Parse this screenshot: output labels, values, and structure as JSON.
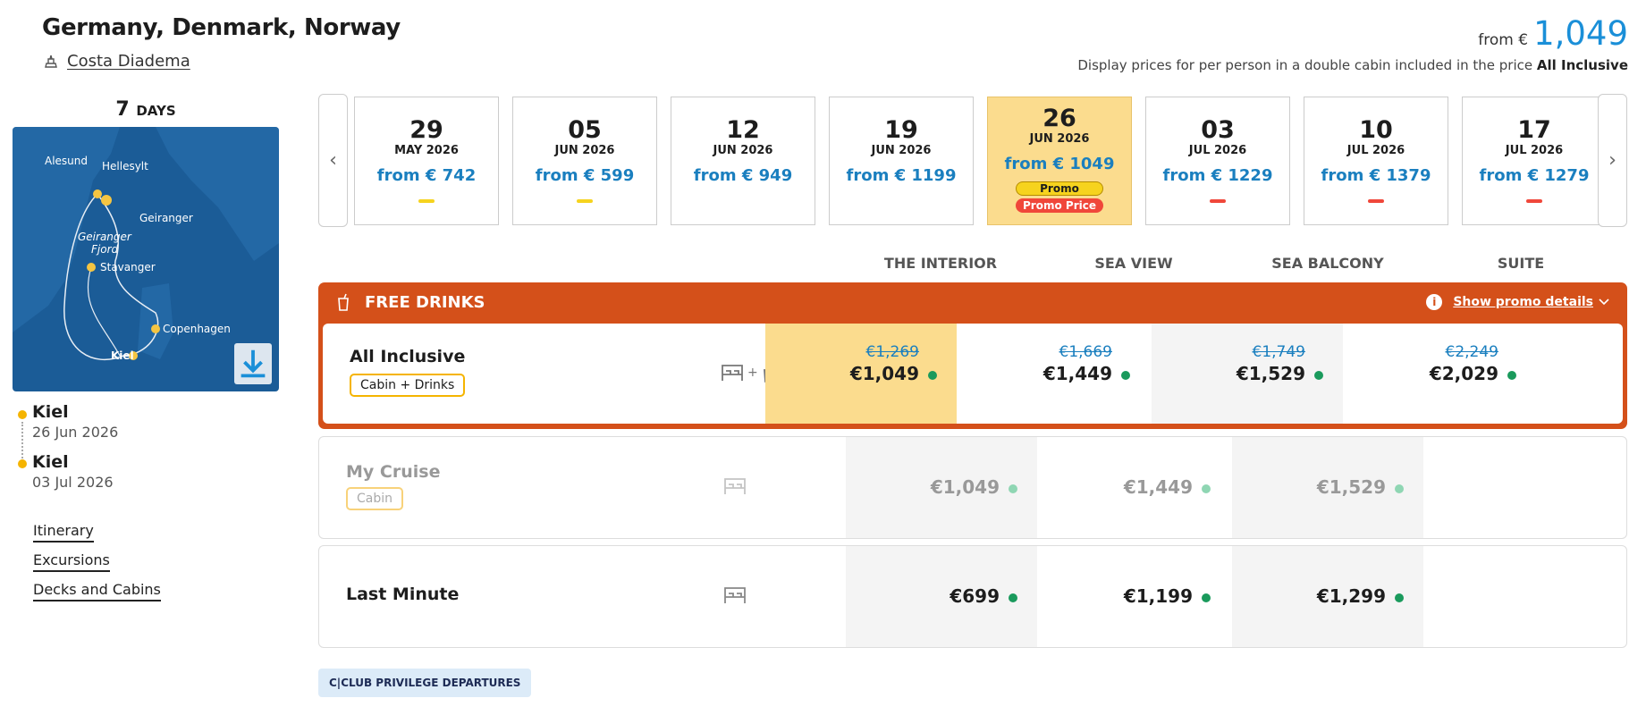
{
  "header": {
    "title": "Germany, Denmark, Norway",
    "ship": "Costa Diadema",
    "from_label": "from €",
    "from_value": "1,049",
    "note_text": "Display prices for per person in a double cabin included in the price",
    "note_bold": "All Inclusive"
  },
  "left": {
    "days_num": "7",
    "days_label": "DAYS",
    "map_labels": [
      "Alesund",
      "Hellesylt",
      "Geiranger",
      "Geiranger",
      "Fjord",
      "Stavanger",
      "Copenhagen",
      "Kiel"
    ],
    "ports": [
      {
        "name": "Kiel",
        "date": "26 Jun 2026"
      },
      {
        "name": "Kiel",
        "date": "03 Jul 2026"
      }
    ],
    "links": [
      "Itinerary",
      "Excursions",
      "Decks and Cabins"
    ]
  },
  "carousel": {
    "prev": "‹",
    "next": "›",
    "dates": [
      {
        "day": "29",
        "month": "MAY 2026",
        "price": "from € 742",
        "bar": "#f6d31e"
      },
      {
        "day": "05",
        "month": "JUN 2026",
        "price": "from € 599",
        "bar": "#f6d31e"
      },
      {
        "day": "12",
        "month": "JUN 2026",
        "price": "from € 949",
        "bar": ""
      },
      {
        "day": "19",
        "month": "JUN 2026",
        "price": "from € 1199",
        "bar": ""
      },
      {
        "day": "26",
        "month": "JUN 2026",
        "price": "from € 1049",
        "bar": "",
        "selected": true,
        "promo": "Promo",
        "promo_price": "Promo Price"
      },
      {
        "day": "03",
        "month": "JUL 2026",
        "price": "from € 1229",
        "bar": "#f0473a"
      },
      {
        "day": "10",
        "month": "JUL 2026",
        "price": "from € 1379",
        "bar": "#f0473a"
      },
      {
        "day": "17",
        "month": "JUL 2026",
        "price": "from € 1279",
        "bar": "#f0473a"
      }
    ]
  },
  "cabins": [
    "THE INTERIOR",
    "SEA VIEW",
    "SEA BALCONY",
    "SUITE"
  ],
  "promo": {
    "title": "FREE DRINKS",
    "details": "Show promo details"
  },
  "fares": [
    {
      "name": "All Inclusive",
      "tag": "Cabin + Drinks",
      "prices": [
        {
          "old": "€1,269",
          "new": "€1,049"
        },
        {
          "old": "€1,669",
          "new": "€1,449"
        },
        {
          "old": "€1,749",
          "new": "€1,529"
        },
        {
          "old": "€2,249",
          "new": "€2,029"
        }
      ]
    },
    {
      "name": "My Cruise",
      "tag": "Cabin",
      "prices": [
        {
          "new": "€1,049"
        },
        {
          "new": "€1,449"
        },
        {
          "new": "€1,529"
        }
      ]
    },
    {
      "name": "Last Minute",
      "prices": [
        {
          "new": "€699"
        },
        {
          "new": "€1,199"
        },
        {
          "new": "€1,299"
        }
      ]
    }
  ],
  "club": "C|CLUB PRIVILEGE DEPARTURES",
  "colors": {
    "accent": "#1a8fd8",
    "promo": "#d4501a",
    "selected": "#fbdc8e",
    "available": "#1a9a5c"
  }
}
